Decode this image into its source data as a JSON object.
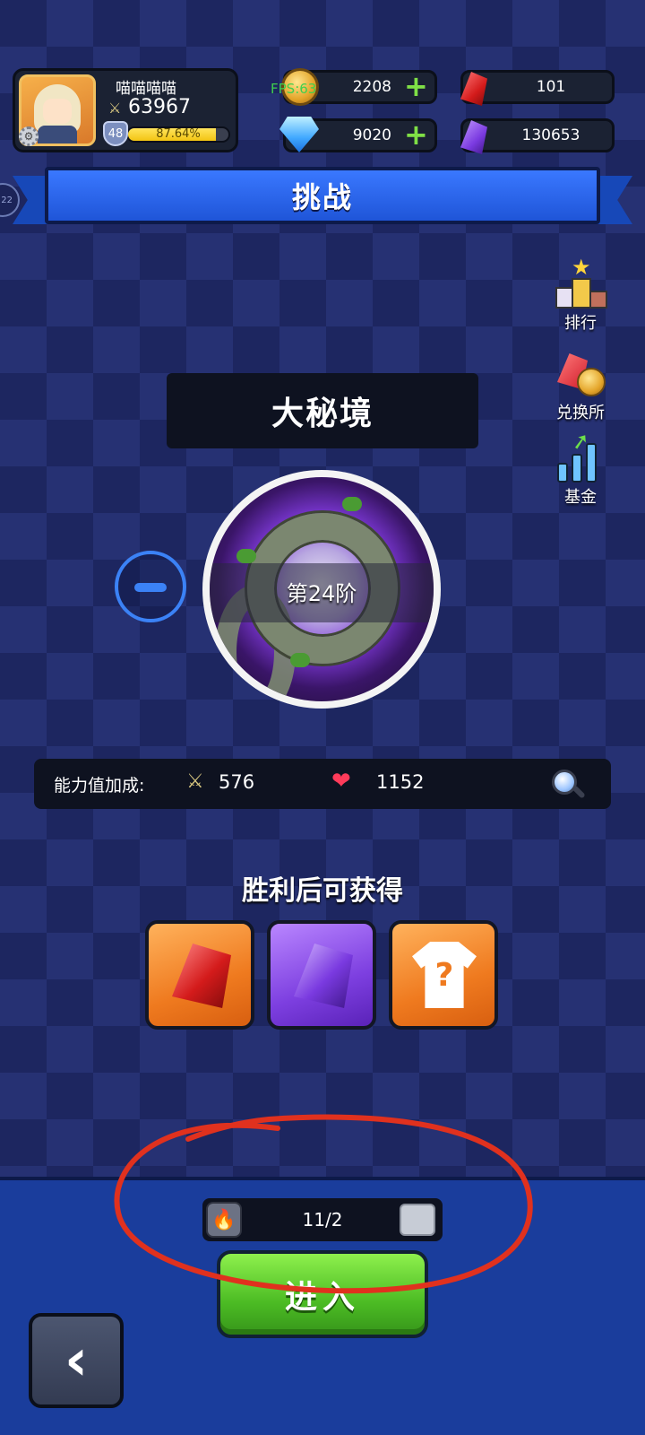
{
  "player": {
    "name": "喵喵喵喵",
    "power": "63967",
    "level": "48",
    "xp_percent_text": "87.64%",
    "xp_fraction": 0.8764
  },
  "resources": {
    "gold": "2208",
    "diamond": "9020",
    "red_crystal": "101",
    "purple_crystal": "130653"
  },
  "debug": {
    "fps_label": "FPS:63"
  },
  "side_badge": "22",
  "header": {
    "title": "挑战"
  },
  "side_menu": [
    {
      "label": "排行",
      "icon": "ranking-podium-icon"
    },
    {
      "label": "兑换所",
      "icon": "exchange-icon"
    },
    {
      "label": "基金",
      "icon": "fund-chart-icon"
    }
  ],
  "stage": {
    "mode_title": "大秘境",
    "tier_label": "第24阶"
  },
  "ability": {
    "label": "能力值加成:",
    "attack": "576",
    "hp": "1152"
  },
  "rewards": {
    "title": "胜利后可获得",
    "items": [
      {
        "icon": "red-crystal-icon",
        "bg": "#ef7a1f"
      },
      {
        "icon": "purple-crystal-icon",
        "bg": "#7d3fe0"
      },
      {
        "icon": "mystery-outfit-icon",
        "bg": "#ef7a1f",
        "mark": "?"
      }
    ]
  },
  "ticket": {
    "count": "11/2"
  },
  "enter_button": {
    "label": "进入"
  },
  "colors": {
    "accent_blue": "#1f55d8",
    "enter_green": "#4cbc24",
    "annotation_red": "#e0311e"
  }
}
